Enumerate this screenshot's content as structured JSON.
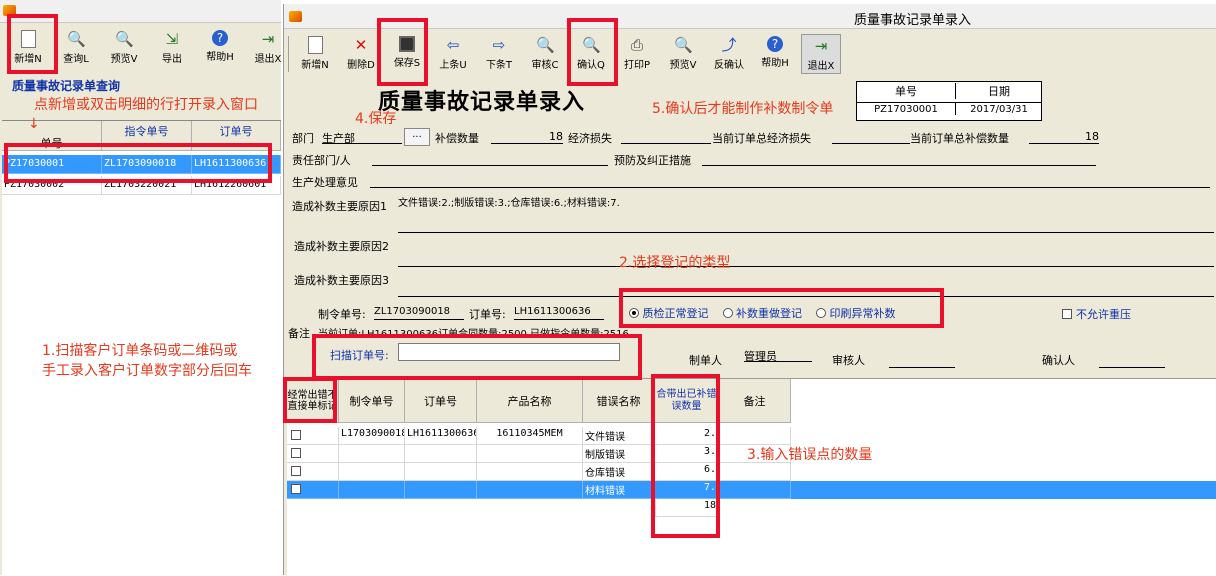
{
  "colors": {
    "accent_red": "#e8102a",
    "annotation": "#e6391e",
    "selection": "#3399ff",
    "blue_text": "#1133aa"
  },
  "left": {
    "toolbar": [
      {
        "label": "新增N",
        "icon": "new-doc-icon"
      },
      {
        "label": "查询L",
        "icon": "query-icon"
      },
      {
        "label": "预览V",
        "icon": "preview-icon"
      },
      {
        "label": "导出",
        "icon": "export-icon"
      },
      {
        "label": "帮助H",
        "icon": "help-icon"
      },
      {
        "label": "退出X",
        "icon": "exit-icon"
      }
    ],
    "panel_title": "质量事故记录单查询",
    "columns": [
      "单号",
      "指令单号",
      "订单号"
    ],
    "rows": [
      [
        "PZ17030001",
        "ZL1703090018",
        "LH1611300636"
      ],
      [
        "PZ17030002",
        "ZL1703220021",
        "LH1612260601"
      ]
    ]
  },
  "right": {
    "window_title": "质量事故记录单录入",
    "toolbar": [
      {
        "label": "新增N",
        "icon": "new-doc-icon"
      },
      {
        "label": "删除D",
        "icon": "delete-icon"
      },
      {
        "label": "保存S",
        "icon": "save-icon"
      },
      {
        "label": "上条U",
        "icon": "prev-icon"
      },
      {
        "label": "下条T",
        "icon": "next-icon"
      },
      {
        "label": "审核C",
        "icon": "audit-icon"
      },
      {
        "label": "确认Q",
        "icon": "confirm-icon"
      },
      {
        "label": "打印P",
        "icon": "print-icon"
      },
      {
        "label": "预览V",
        "icon": "preview-icon"
      },
      {
        "label": "反确认",
        "icon": "unconfirm-icon"
      },
      {
        "label": "帮助H",
        "icon": "help-icon"
      },
      {
        "label": "退出X",
        "icon": "exit-icon"
      }
    ],
    "form_title": "质量事故记录单录入",
    "docno_label": "单号",
    "date_label": "日期",
    "docno": "PZ17030001",
    "date": "2017/03/31",
    "dept_label": "部门",
    "dept": "生产部",
    "browse": "...",
    "comp_qty_label": "补偿数量",
    "comp_qty": "18",
    "econ_loss_label": "经济损失",
    "cur_order_loss_label": "当前订单总经济损失",
    "cur_order_comp_label": "当前订单总补偿数量",
    "cur_order_comp": "18",
    "resp_label": "责任部门/人",
    "prevent_label": "预防及纠正措施",
    "prod_opinion_label": "生产处理意见",
    "reason1_label": "造成补数主要原因1",
    "reason1": "文件错误:2.;制版错误:3.;仓库错误:6.;材料错误:7.",
    "reason2_label": "造成补数主要原因2",
    "reason3_label": "造成补数主要原因3",
    "order_cmd_label": "制令单号:",
    "order_cmd": "ZL1703090018",
    "order_no_label": "订单号:",
    "order_no": "LH1611300636",
    "radios": [
      "质检正常登记",
      "补数重做登记",
      "印刷异常补数"
    ],
    "no_repress": "不允许重压",
    "remark_label": "备注",
    "remark": "当前订单:LH1611300636订单合同数量:2500,已做指令单数量:2516.",
    "scan_label": "扫描订单号:",
    "maker_label": "制单人",
    "maker": "管理员",
    "auditor_label": "审核人",
    "confirmer_label": "确认人",
    "grid": {
      "headers": [
        "经常出错不直接单标记",
        "制令单号",
        "订单号",
        "产品名称",
        "错误名称",
        "合带出已补错误数量",
        "备注"
      ],
      "rows": [
        {
          "order_cmd": "L1703090018",
          "order_no": "LH1611300636",
          "product": "16110345MEM",
          "error": "文件错误",
          "qty": "2."
        },
        {
          "order_cmd": "",
          "order_no": "",
          "product": "",
          "error": "制版错误",
          "qty": "3."
        },
        {
          "order_cmd": "",
          "order_no": "",
          "product": "",
          "error": "仓库错误",
          "qty": "6."
        },
        {
          "order_cmd": "",
          "order_no": "",
          "product": "",
          "error": "材料错误",
          "qty": "7."
        }
      ],
      "total": "18"
    }
  },
  "annotations": {
    "a0": "点新增或双击明细的行打开录入窗口",
    "a1a": "1.扫描客户订单条码或二维码或",
    "a1b": "手工录入客户订单数字部分后回车",
    "a2": "2.选择登记的类型",
    "a3": "3.输入错误点的数量",
    "a4": "4.保存",
    "a5": "5.确认后才能制作补数制令单"
  }
}
